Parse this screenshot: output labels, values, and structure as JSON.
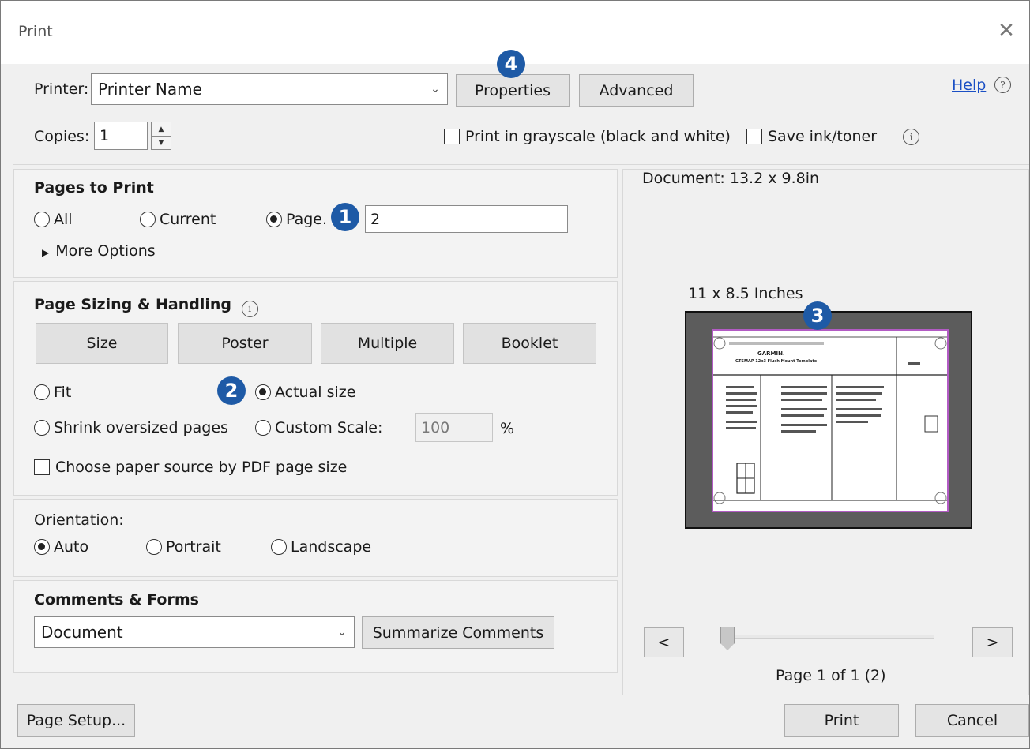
{
  "window": {
    "title": "Print",
    "close_glyph": "✕"
  },
  "printer": {
    "label": "Printer:",
    "name": "Printer Name",
    "properties": "Properties",
    "advanced": "Advanced",
    "help": "Help"
  },
  "copies": {
    "label": "Copies:",
    "value": "1"
  },
  "options": {
    "grayscale": "Print in grayscale (black and white)",
    "save_ink": "Save ink/toner"
  },
  "pages_to_print": {
    "heading": "Pages to Print",
    "all": "All",
    "current": "Current",
    "pages": "Page.",
    "pages_value": "2",
    "more_options": "More Options",
    "selected": "pages"
  },
  "sizing": {
    "heading": "Page Sizing & Handling",
    "buttons": [
      "Size",
      "Poster",
      "Multiple",
      "Booklet"
    ],
    "fit": "Fit",
    "actual_size": "Actual size",
    "shrink": "Shrink oversized pages",
    "custom_scale": "Custom Scale:",
    "scale_value": "100",
    "percent": "%",
    "paper_source": "Choose paper source by PDF page size",
    "selected": "actual_size"
  },
  "orientation": {
    "heading": "Orientation:",
    "auto": "Auto",
    "portrait": "Portrait",
    "landscape": "Landscape",
    "selected": "auto"
  },
  "comments": {
    "heading": "Comments & Forms",
    "value": "Document",
    "summarize": "Summarize Comments"
  },
  "preview": {
    "document_size": "Document: 13.2 x 9.8in",
    "paper_size": "11 x 8.5 Inches",
    "page_label": "Page 1 of 1 (2)",
    "prev": "<",
    "next": ">",
    "slider_position": 0,
    "logo_text": "GARMIN.",
    "page_heading": "GTSMAP 12x3 Flush Mount Template"
  },
  "footer": {
    "page_setup": "Page Setup...",
    "print": "Print",
    "cancel": "Cancel"
  },
  "callouts": [
    "1",
    "2",
    "3",
    "4"
  ],
  "colors": {
    "callout": "#1e5aa6",
    "page_border": "#b25bc4",
    "link": "#1a4fc4"
  }
}
